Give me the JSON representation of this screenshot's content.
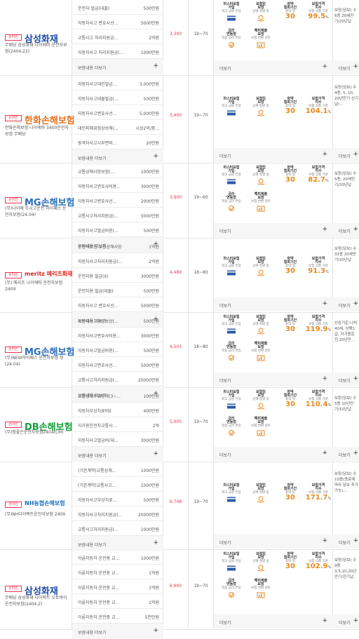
{
  "ui": {
    "more_coverage": "보장내용 더보기",
    "more": "더보기",
    "plus": "+",
    "badge": "온라인",
    "age_unit": "세",
    "ratio_unit": "%"
  },
  "feature_labels": {
    "electric_car": {
      "title": "마스터보험\n가입",
      "sub": "최고 금원 전용"
    },
    "accident_cover": {
      "title": "보험임\n모방",
      "sub": "상해 질병 등"
    },
    "reward": {
      "title": "창약\n철회기간",
      "sub": "창약 일"
    },
    "premium_index": {
      "title": "보험가격\n지수",
      "sub": "보험 상품 기준"
    },
    "hybrid": {
      "title": "금리\n연동형",
      "sub": "적용 금리 연동"
    },
    "refund": {
      "title": "해지환급\n보장",
      "sub": "기간 환 감시"
    },
    "refund2": {
      "title": "해피제출\n보장",
      "sub": "보험 변환 검토"
    }
  },
  "rows": [
    {
      "company": "삼성화재",
      "logo_color": "#1c4aa6",
      "product": "무배당 삼성화재 나이에따 운전자보험(2404.22)",
      "coverages": [
        {
          "name": "운전자 벌금(대물)",
          "amount": "500만원"
        },
        {
          "name": "자동차사고 변호사선...",
          "amount": "5000만원"
        },
        {
          "name": "교통사고 처리지원금...",
          "amount": "2억원"
        },
        {
          "name": "자동차사고 처리지원금(...",
          "amount": "1000만원"
        }
      ],
      "price": "3,300",
      "age": "19~70",
      "reward_days": "30",
      "index_value": "99.5",
      "second_row": true,
      "extra": "보장(담보) 수 6종 20세만기/20년납"
    },
    {
      "company": "한화손해보험",
      "logo_color": "#e8701c",
      "product": "한화손해보험 나이에따 3400운전자보험 무배당",
      "coverages": [
        {
          "name": "자동차사고대인벌금...",
          "amount": "3,000만원"
        },
        {
          "name": "자동차사고대물벌금(...",
          "amount": "500만원"
        },
        {
          "name": "자동차사고변호사선...",
          "amount": "5,000만원"
        },
        {
          "name": "대인피해위험상승에(...",
          "amount": "시상2억/중..."
        },
        {
          "name": "원격자사고시부변비...",
          "amount": "20만원"
        }
      ],
      "price": "3,400",
      "age": "19~70",
      "reward_days": "30",
      "index_value": "104.1",
      "second_row": false,
      "extra": "보장(담보) 수 4종, 5, 10, 20년만기 선기납(..."
    },
    {
      "company": "MG손해보험",
      "logo_color": "#2a6fb8",
      "product": "(무)나이에 무시고운전 하이패스 운전자보험(24.04)",
      "coverages": [
        {
          "name": "교통상해사망보험(...",
          "amount": "1000만원"
        },
        {
          "name": "자동차사고변호사비용...",
          "amount": "3000만원"
        },
        {
          "name": "자동차사고변호사선...",
          "amount": "2000만원"
        },
        {
          "name": "교통사고처리지원금(...",
          "amount": "5000만원"
        },
        {
          "name": "자동차사고벌금비용(...",
          "amount": "500만원"
        }
      ],
      "price": "3,900",
      "age": "19~60",
      "reward_days": "30",
      "index_value": "82.7",
      "second_row": true,
      "extra": "보장(담보) 수 5종, 20세만기/20년납"
    },
    {
      "company": "meritz 메리츠화재",
      "logo_color": "#d8221c",
      "product": "(무) 메리츠 나이에따 운전자보험 2409",
      "coverages": [
        {
          "name": "운전자보험 교통상해사망",
          "amount": "1억원"
        },
        {
          "name": "자동차사고처리지원금(...",
          "amount": "2억원"
        },
        {
          "name": "운전자용 벌금(II)",
          "amount": "3000만원"
        },
        {
          "name": "운전자용 벌금(대물)",
          "amount": "500만원"
        },
        {
          "name": "자동차사고 변호사선...",
          "amount": "5000만원"
        }
      ],
      "price": "4,489",
      "age": "18~80",
      "reward_days": "30",
      "index_value": "91.3",
      "second_row": false,
      "extra": "보장(담보) 수 33종 20세만기/20년납"
    },
    {
      "company": "MG손해보험",
      "logo_color": "#2a6fb8",
      "product": "(무)NEW하이패스 운전자보험 형(24.04)",
      "coverages": [
        {
          "name": "자동차사고부상보상(...",
          "amount": "500만원"
        },
        {
          "name": "자동차사고변호사비용...",
          "amount": "3000만원"
        },
        {
          "name": "자동차사고벌금비용(...",
          "amount": "500만원"
        },
        {
          "name": "자동차사고변호사선...",
          "amount": "5000만원"
        },
        {
          "name": "교통사고처리지원금(...",
          "amount": "20000만원"
        }
      ],
      "price": "4,503",
      "age": "18~80",
      "reward_days": "30",
      "index_value": "119.9",
      "second_row": true,
      "extra": "선승기준:나처 40세, 상해1급, 자기용운전,20년만..."
    },
    {
      "company": "DB손해보험",
      "logo_color": "#14a03c",
      "product": "(무)참좋은운전자보험2404(CM)",
      "coverages": [
        {
          "name": "교통상해후유장해(3~...",
          "amount": "100만원"
        },
        {
          "name": "자동차부상치료비II",
          "amount": "400만원"
        },
        {
          "name": "자가용운전자교통사...",
          "amount": "2억"
        },
        {
          "name": "자동차사고벌금비(대...",
          "amount": "3000만원"
        }
      ],
      "price": "5,005",
      "age": "19~70",
      "reward_days": "30",
      "index_value": "110.4",
      "second_row": true,
      "extra": "보장(담보) 수 5종 10년만기/10년납"
    },
    {
      "company": "NH농협손해보험",
      "logo_color": "#1c6fb8",
      "product": "(무)NH다이렉트운전자보험 2409",
      "coverages": [
        {
          "name": "(기본계약)교통상해...",
          "amount": "1000만원"
        },
        {
          "name": "(기본계약)교통사고...",
          "amount": "1000만원"
        },
        {
          "name": "자동차사고부상치료...",
          "amount": "500만원"
        },
        {
          "name": "자동차사고처리지원금(...",
          "amount": "20000만원"
        },
        {
          "name": "교통사고처리지원금(...",
          "amount": "1000만원"
        }
      ],
      "price": "6,748",
      "age": "19~70",
      "reward_days": "30",
      "index_value": "171.7",
      "second_row": false,
      "extra": "보장(담보) 수 10종(종료에 따라 담보 추가 가능)..."
    },
    {
      "company": "삼성화재",
      "logo_color": "#1c4aa6",
      "product": "무배당 삼성화재 다이렉트 오토바이 운전자보험(2404.2)",
      "coverages": [
        {
          "name": "이륜자동차 운전중 교...",
          "amount": "1000만원"
        },
        {
          "name": "이륜자동차 운전중 교...",
          "amount": "1억원"
        },
        {
          "name": "이륜자동차 운전중 교...",
          "amount": "1억원"
        },
        {
          "name": "이륜자동차 운전중 교...",
          "amount": "1억원"
        },
        {
          "name": "이륜자동차 운전중 교...",
          "amount": "5천만원"
        }
      ],
      "price": "6,900",
      "age": "19~70",
      "reward_days": "30",
      "index_value": "102.9",
      "second_row": true,
      "extra": "보장(담보) 수 9종 3,5,10,20년만기/전기납"
    }
  ]
}
